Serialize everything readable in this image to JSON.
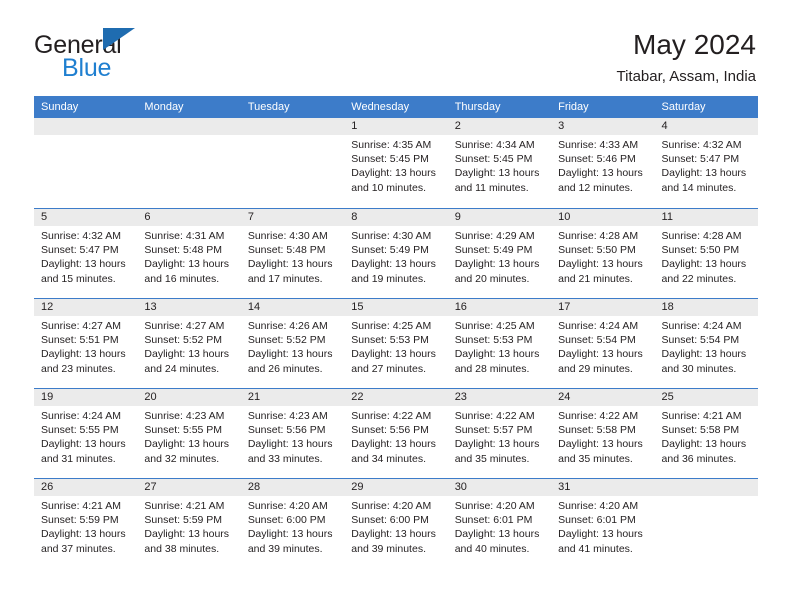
{
  "brand": {
    "name_top": "General",
    "name_bottom": "Blue",
    "mark": "triangle-logo-mark",
    "colors": {
      "top_text": "#231f20",
      "bottom_text": "#1f7fd0",
      "mark": "#1f6cb0"
    }
  },
  "header": {
    "title": "May 2024",
    "subtitle": "Titabar, Assam, India"
  },
  "theme": {
    "header_blue": "#3d7cc9",
    "day_strip_gray": "#ebebeb",
    "text": "#231f20"
  },
  "calendar": {
    "weekday_headers": [
      "Sunday",
      "Monday",
      "Tuesday",
      "Wednesday",
      "Thursday",
      "Friday",
      "Saturday"
    ],
    "weeks": [
      [
        {
          "day": "",
          "empty": true,
          "lines": []
        },
        {
          "day": "",
          "empty": true,
          "lines": []
        },
        {
          "day": "",
          "empty": true,
          "lines": []
        },
        {
          "day": "1",
          "empty": false,
          "lines": [
            "Sunrise: 4:35 AM",
            "Sunset: 5:45 PM",
            "Daylight: 13 hours",
            "and 10 minutes."
          ]
        },
        {
          "day": "2",
          "empty": false,
          "lines": [
            "Sunrise: 4:34 AM",
            "Sunset: 5:45 PM",
            "Daylight: 13 hours",
            "and 11 minutes."
          ]
        },
        {
          "day": "3",
          "empty": false,
          "lines": [
            "Sunrise: 4:33 AM",
            "Sunset: 5:46 PM",
            "Daylight: 13 hours",
            "and 12 minutes."
          ]
        },
        {
          "day": "4",
          "empty": false,
          "lines": [
            "Sunrise: 4:32 AM",
            "Sunset: 5:47 PM",
            "Daylight: 13 hours",
            "and 14 minutes."
          ]
        }
      ],
      [
        {
          "day": "5",
          "empty": false,
          "lines": [
            "Sunrise: 4:32 AM",
            "Sunset: 5:47 PM",
            "Daylight: 13 hours",
            "and 15 minutes."
          ]
        },
        {
          "day": "6",
          "empty": false,
          "lines": [
            "Sunrise: 4:31 AM",
            "Sunset: 5:48 PM",
            "Daylight: 13 hours",
            "and 16 minutes."
          ]
        },
        {
          "day": "7",
          "empty": false,
          "lines": [
            "Sunrise: 4:30 AM",
            "Sunset: 5:48 PM",
            "Daylight: 13 hours",
            "and 17 minutes."
          ]
        },
        {
          "day": "8",
          "empty": false,
          "lines": [
            "Sunrise: 4:30 AM",
            "Sunset: 5:49 PM",
            "Daylight: 13 hours",
            "and 19 minutes."
          ]
        },
        {
          "day": "9",
          "empty": false,
          "lines": [
            "Sunrise: 4:29 AM",
            "Sunset: 5:49 PM",
            "Daylight: 13 hours",
            "and 20 minutes."
          ]
        },
        {
          "day": "10",
          "empty": false,
          "lines": [
            "Sunrise: 4:28 AM",
            "Sunset: 5:50 PM",
            "Daylight: 13 hours",
            "and 21 minutes."
          ]
        },
        {
          "day": "11",
          "empty": false,
          "lines": [
            "Sunrise: 4:28 AM",
            "Sunset: 5:50 PM",
            "Daylight: 13 hours",
            "and 22 minutes."
          ]
        }
      ],
      [
        {
          "day": "12",
          "empty": false,
          "lines": [
            "Sunrise: 4:27 AM",
            "Sunset: 5:51 PM",
            "Daylight: 13 hours",
            "and 23 minutes."
          ]
        },
        {
          "day": "13",
          "empty": false,
          "lines": [
            "Sunrise: 4:27 AM",
            "Sunset: 5:52 PM",
            "Daylight: 13 hours",
            "and 24 minutes."
          ]
        },
        {
          "day": "14",
          "empty": false,
          "lines": [
            "Sunrise: 4:26 AM",
            "Sunset: 5:52 PM",
            "Daylight: 13 hours",
            "and 26 minutes."
          ]
        },
        {
          "day": "15",
          "empty": false,
          "lines": [
            "Sunrise: 4:25 AM",
            "Sunset: 5:53 PM",
            "Daylight: 13 hours",
            "and 27 minutes."
          ]
        },
        {
          "day": "16",
          "empty": false,
          "lines": [
            "Sunrise: 4:25 AM",
            "Sunset: 5:53 PM",
            "Daylight: 13 hours",
            "and 28 minutes."
          ]
        },
        {
          "day": "17",
          "empty": false,
          "lines": [
            "Sunrise: 4:24 AM",
            "Sunset: 5:54 PM",
            "Daylight: 13 hours",
            "and 29 minutes."
          ]
        },
        {
          "day": "18",
          "empty": false,
          "lines": [
            "Sunrise: 4:24 AM",
            "Sunset: 5:54 PM",
            "Daylight: 13 hours",
            "and 30 minutes."
          ]
        }
      ],
      [
        {
          "day": "19",
          "empty": false,
          "lines": [
            "Sunrise: 4:24 AM",
            "Sunset: 5:55 PM",
            "Daylight: 13 hours",
            "and 31 minutes."
          ]
        },
        {
          "day": "20",
          "empty": false,
          "lines": [
            "Sunrise: 4:23 AM",
            "Sunset: 5:55 PM",
            "Daylight: 13 hours",
            "and 32 minutes."
          ]
        },
        {
          "day": "21",
          "empty": false,
          "lines": [
            "Sunrise: 4:23 AM",
            "Sunset: 5:56 PM",
            "Daylight: 13 hours",
            "and 33 minutes."
          ]
        },
        {
          "day": "22",
          "empty": false,
          "lines": [
            "Sunrise: 4:22 AM",
            "Sunset: 5:56 PM",
            "Daylight: 13 hours",
            "and 34 minutes."
          ]
        },
        {
          "day": "23",
          "empty": false,
          "lines": [
            "Sunrise: 4:22 AM",
            "Sunset: 5:57 PM",
            "Daylight: 13 hours",
            "and 35 minutes."
          ]
        },
        {
          "day": "24",
          "empty": false,
          "lines": [
            "Sunrise: 4:22 AM",
            "Sunset: 5:58 PM",
            "Daylight: 13 hours",
            "and 35 minutes."
          ]
        },
        {
          "day": "25",
          "empty": false,
          "lines": [
            "Sunrise: 4:21 AM",
            "Sunset: 5:58 PM",
            "Daylight: 13 hours",
            "and 36 minutes."
          ]
        }
      ],
      [
        {
          "day": "26",
          "empty": false,
          "lines": [
            "Sunrise: 4:21 AM",
            "Sunset: 5:59 PM",
            "Daylight: 13 hours",
            "and 37 minutes."
          ]
        },
        {
          "day": "27",
          "empty": false,
          "lines": [
            "Sunrise: 4:21 AM",
            "Sunset: 5:59 PM",
            "Daylight: 13 hours",
            "and 38 minutes."
          ]
        },
        {
          "day": "28",
          "empty": false,
          "lines": [
            "Sunrise: 4:20 AM",
            "Sunset: 6:00 PM",
            "Daylight: 13 hours",
            "and 39 minutes."
          ]
        },
        {
          "day": "29",
          "empty": false,
          "lines": [
            "Sunrise: 4:20 AM",
            "Sunset: 6:00 PM",
            "Daylight: 13 hours",
            "and 39 minutes."
          ]
        },
        {
          "day": "30",
          "empty": false,
          "lines": [
            "Sunrise: 4:20 AM",
            "Sunset: 6:01 PM",
            "Daylight: 13 hours",
            "and 40 minutes."
          ]
        },
        {
          "day": "31",
          "empty": false,
          "lines": [
            "Sunrise: 4:20 AM",
            "Sunset: 6:01 PM",
            "Daylight: 13 hours",
            "and 41 minutes."
          ]
        },
        {
          "day": "",
          "empty": true,
          "lines": []
        }
      ]
    ]
  }
}
